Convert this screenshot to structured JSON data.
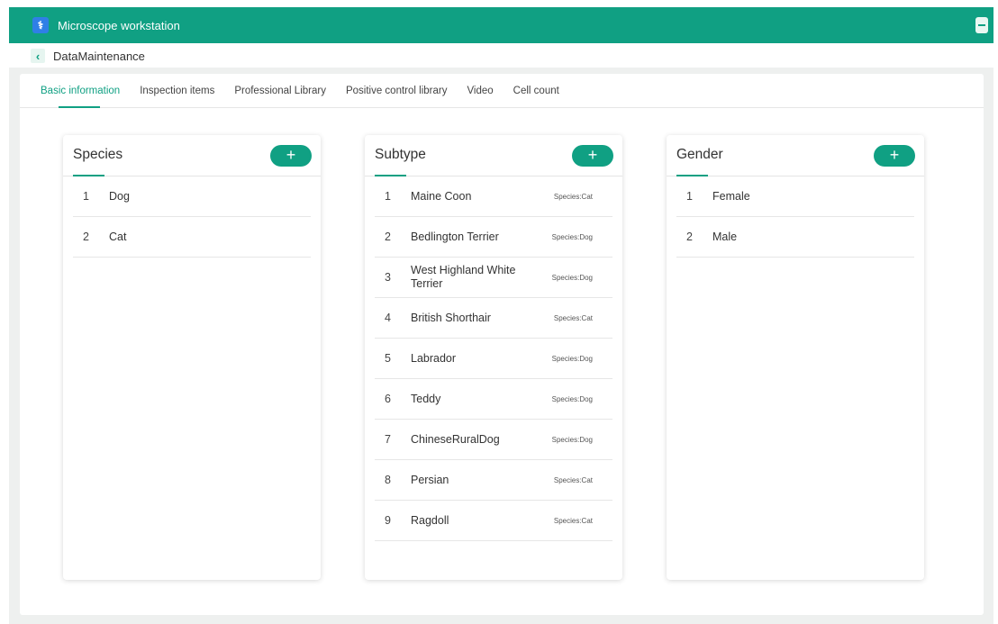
{
  "titlebar": {
    "title": "Microscope workstation",
    "icon": "microscope-icon"
  },
  "subbar": {
    "breadcrumb": "DataMaintenance",
    "back_icon": "chevron-left-icon"
  },
  "tabs": [
    {
      "label": "Basic information",
      "active": true
    },
    {
      "label": "Inspection items"
    },
    {
      "label": "Professional Library"
    },
    {
      "label": "Positive control library"
    },
    {
      "label": "Video"
    },
    {
      "label": "Cell count"
    }
  ],
  "colors": {
    "accent": "#10a083",
    "background": "#eef0ef"
  },
  "species": {
    "title": "Species",
    "add_label": "+",
    "items": [
      {
        "index": "1",
        "name": "Dog"
      },
      {
        "index": "2",
        "name": "Cat"
      }
    ]
  },
  "subtype": {
    "title": "Subtype",
    "add_label": "+",
    "items": [
      {
        "index": "1",
        "name": "Maine Coon",
        "tag": "Species:Cat"
      },
      {
        "index": "2",
        "name": "Bedlington Terrier",
        "tag": "Species:Dog"
      },
      {
        "index": "3",
        "name": "West Highland White Terrier",
        "tag": "Species:Dog"
      },
      {
        "index": "4",
        "name": "British Shorthair",
        "tag": "Species:Cat"
      },
      {
        "index": "5",
        "name": "Labrador",
        "tag": "Species:Dog"
      },
      {
        "index": "6",
        "name": "Teddy",
        "tag": "Species:Dog"
      },
      {
        "index": "7",
        "name": "ChineseRuralDog",
        "tag": "Species:Dog"
      },
      {
        "index": "8",
        "name": "Persian",
        "tag": "Species:Cat"
      },
      {
        "index": "9",
        "name": "Ragdoll",
        "tag": "Species:Cat"
      }
    ]
  },
  "gender": {
    "title": "Gender",
    "add_label": "+",
    "items": [
      {
        "index": "1",
        "name": "Female"
      },
      {
        "index": "2",
        "name": "Male"
      }
    ]
  }
}
